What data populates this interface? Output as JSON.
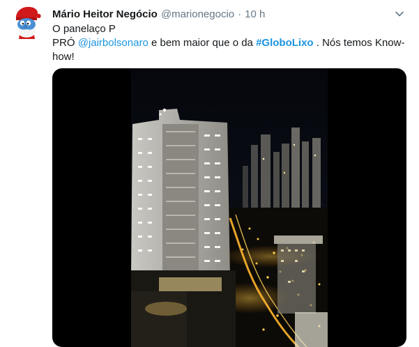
{
  "tweet": {
    "author_name": "Mário Heitor Negócio",
    "handle": "@marionegocio",
    "separator": "·",
    "time": "10 h",
    "line1": "O panelaço P",
    "line2_prefix": "PRÓ ",
    "mention": "@jairbolsonaro",
    "line2_middle": " e bem maior que o da ",
    "hashtag": "#GloboLixo",
    "line2_suffix": " . Nós temos Know-how!"
  },
  "icons": {
    "avatar": "papa-smurf-avatar",
    "menu": "chevron-down-icon"
  },
  "colors": {
    "link": "#1b95e0",
    "secondary_text": "#657786",
    "primary_text": "#14171a",
    "video_letterbox": "#000000"
  }
}
